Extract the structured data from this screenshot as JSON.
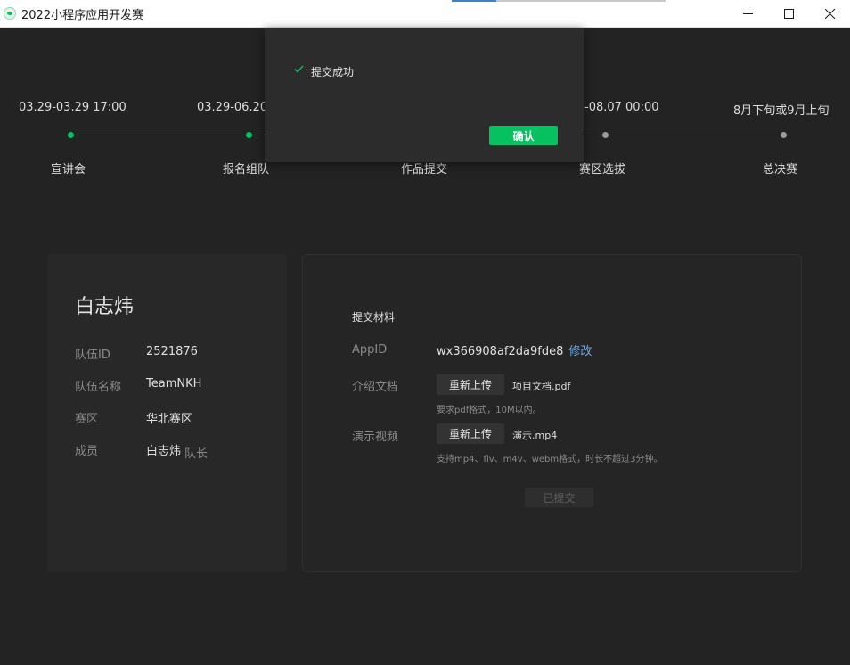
{
  "window": {
    "title": "2022小程序应用开发赛"
  },
  "timeline": [
    {
      "date": "03.29-03.29 17:00",
      "name": "宣讲会"
    },
    {
      "date": "03.29-06.20",
      "name": "报名组队"
    },
    {
      "date": "",
      "name": "作品提交"
    },
    {
      "date": "-08.07 00:00",
      "name": "赛区选拔"
    },
    {
      "date": "8月下旬或9月上旬",
      "name": "总决赛"
    }
  ],
  "colors": {
    "accent": "#07c160",
    "done": "#07a04a",
    "pending": "#9a9a9a",
    "link": "#6fa8dc"
  },
  "team": {
    "user_name": "白志炜",
    "fields": [
      {
        "label": "队伍ID",
        "value": "2521876"
      },
      {
        "label": "队伍名称",
        "value": "TeamNKH"
      },
      {
        "label": "赛区",
        "value": "华北赛区"
      },
      {
        "label": "成员",
        "value": "白志炜",
        "role": "队长"
      }
    ]
  },
  "submission": {
    "title": "提交材料",
    "appid_label": "AppID",
    "appid_value": "wx366908af2da9fde8",
    "appid_edit": "修改",
    "doc_label": "介绍文档",
    "doc_button": "重新上传",
    "doc_file": "项目文档.pdf",
    "doc_hint": "要求pdf格式，10M以内。",
    "video_label": "演示视频",
    "video_button": "重新上传",
    "video_file": "演示.mp4",
    "video_hint": "支持mp4、flv、m4v、webm格式，时长不超过3分钟。",
    "submitted_button": "已提交"
  },
  "dialog": {
    "message": "提交成功",
    "confirm": "确认",
    "icon": "check-icon"
  }
}
